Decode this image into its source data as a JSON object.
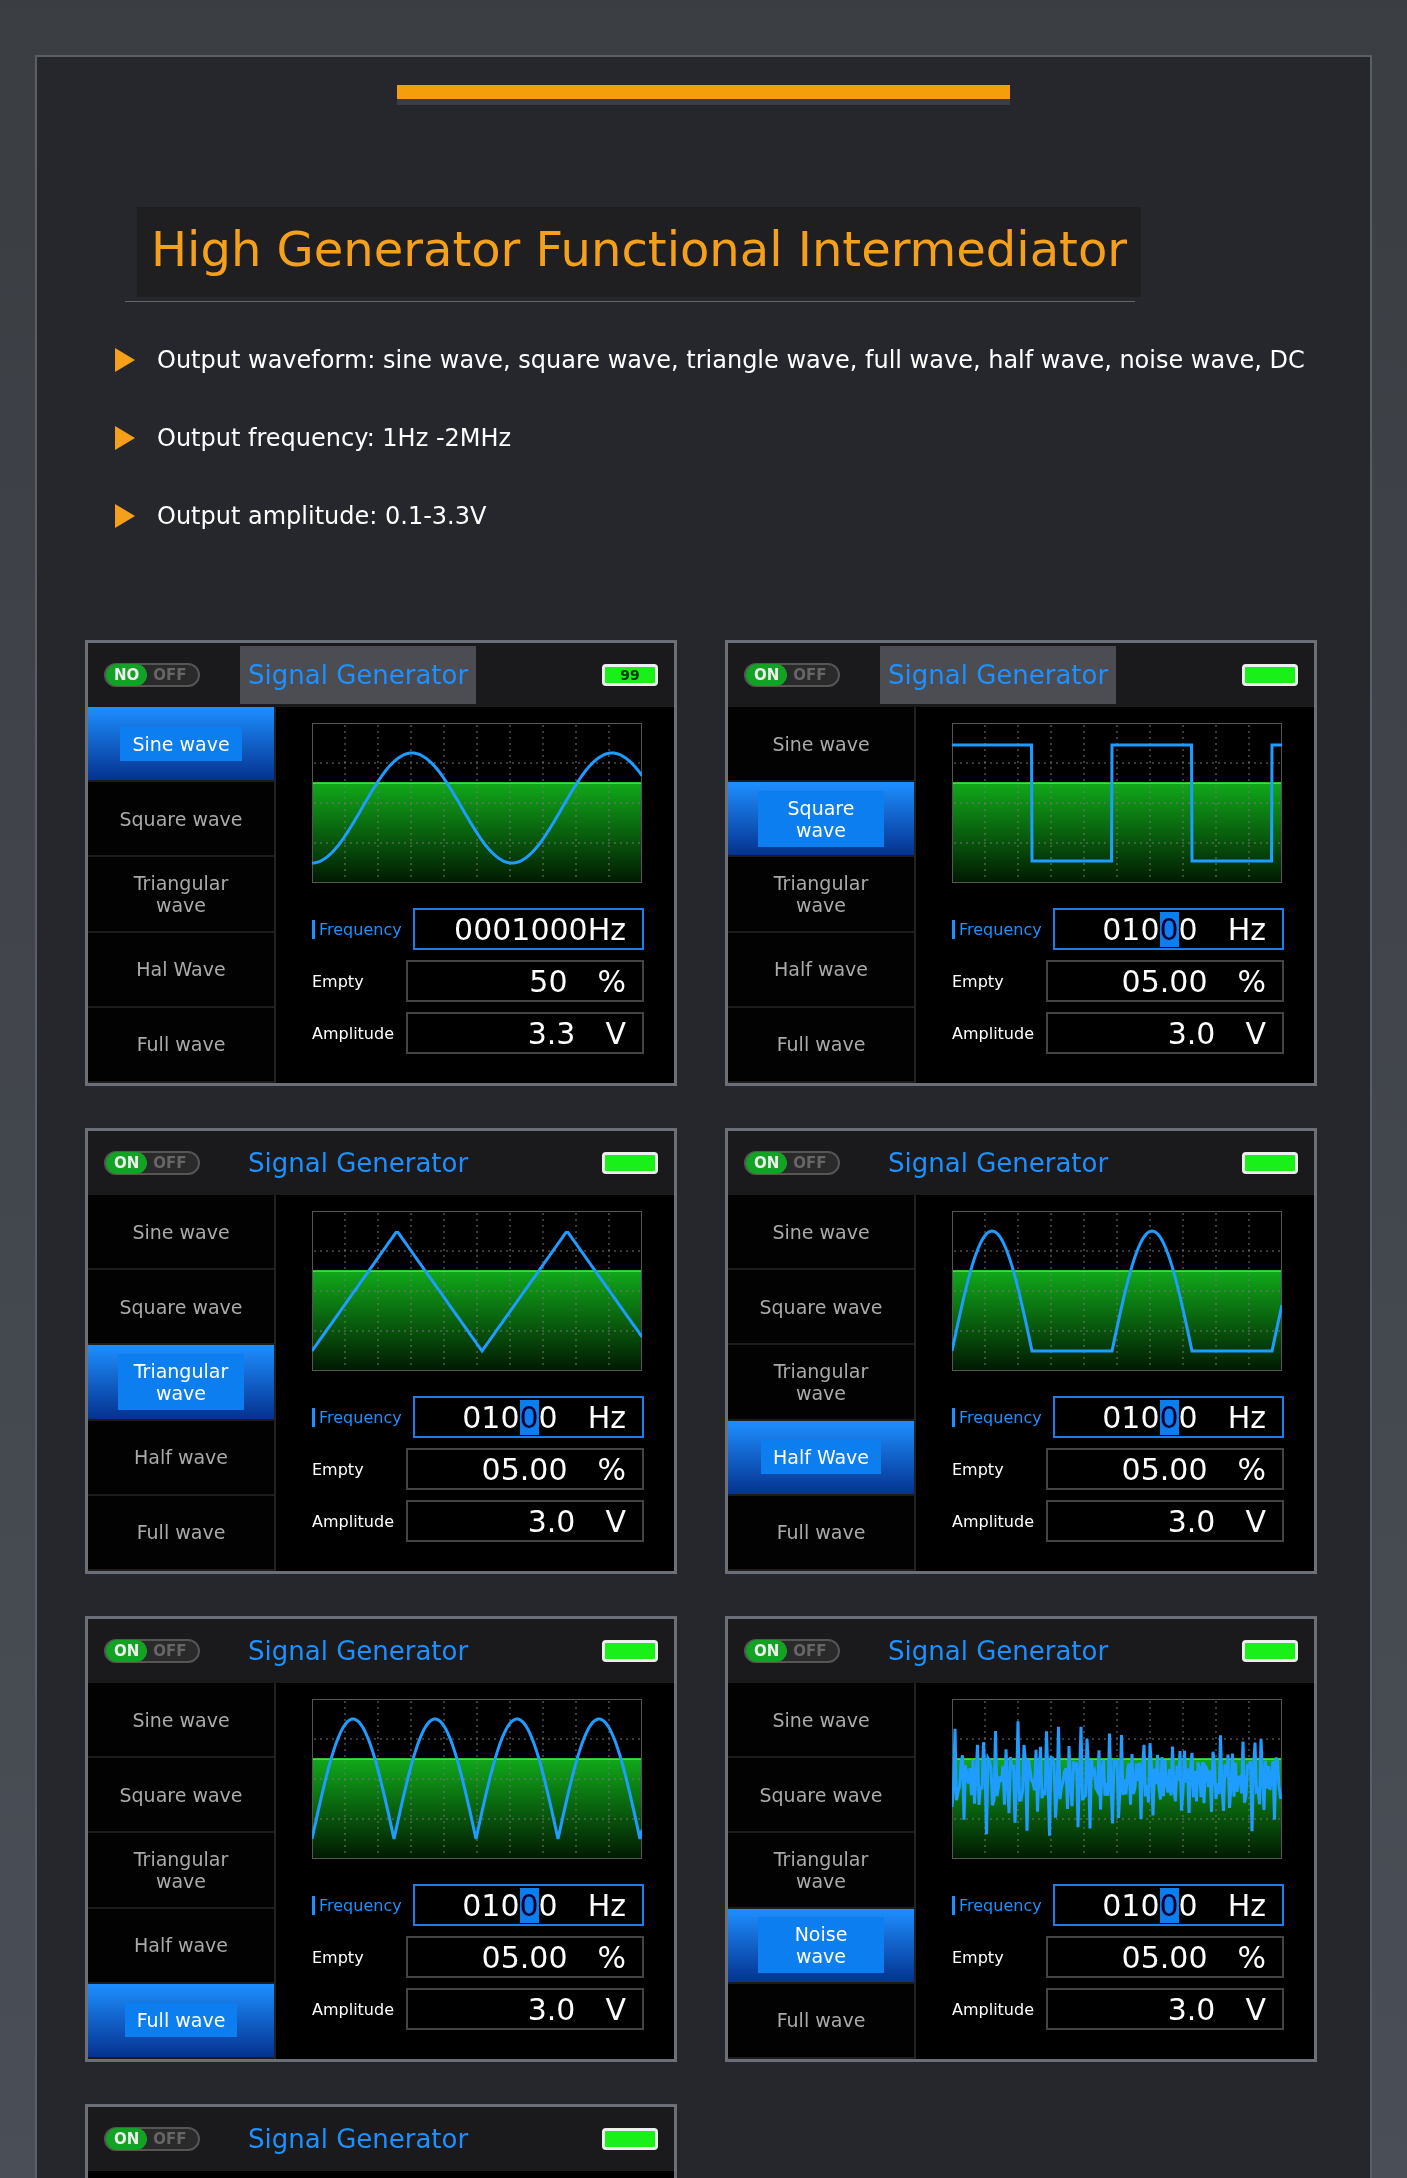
{
  "heading": "High Generator Functional Intermediator",
  "features": [
    "Output waveform: sine wave, square wave, triangle wave, full wave, half wave, noise wave, DC",
    "Output frequency: 1Hz -2MHz",
    "Output amplitude: 0.1-3.3V"
  ],
  "screens": [
    {
      "switch": {
        "on_label": "NO",
        "off_label": "OFF",
        "on": true
      },
      "title": "Signal Generator",
      "title_highlighted": true,
      "battery_text": "99",
      "kind": "sine",
      "menu": [
        {
          "label": "Sine wave",
          "selected": true
        },
        {
          "label": "Square wave",
          "selected": false
        },
        {
          "label": "Triangular wave",
          "selected": false
        },
        {
          "label": "Hal Wave",
          "selected": false
        },
        {
          "label": "Full wave",
          "selected": false
        }
      ],
      "fields": [
        {
          "kind": "frequency",
          "label": "Frequency",
          "value": [
            {
              "text": "0001000Hz",
              "selected": false
            }
          ]
        },
        {
          "kind": "duty",
          "label": "Empty",
          "value": [
            {
              "text": "50",
              "selected": false
            }
          ],
          "unit": "%"
        },
        {
          "kind": "amplitude",
          "label": "Amplitude",
          "value": [
            {
              "text": "3.3",
              "selected": false
            }
          ],
          "unit": "V"
        }
      ]
    },
    {
      "switch": {
        "on_label": "ON",
        "off_label": "OFF",
        "on": true
      },
      "title": "Signal Generator",
      "title_highlighted": true,
      "kind": "square",
      "menu": [
        {
          "label": "Sine wave",
          "selected": false
        },
        {
          "label": "Square wave",
          "selected": true
        },
        {
          "label": "Triangular wave",
          "selected": false
        },
        {
          "label": "Half wave",
          "selected": false
        },
        {
          "label": "Full wave",
          "selected": false
        }
      ],
      "fields": [
        {
          "kind": "frequency",
          "label": "Frequency",
          "value": [
            {
              "text": "010",
              "selected": false
            },
            {
              "text": "0",
              "selected": true
            },
            {
              "text": "0",
              "selected": false
            }
          ],
          "unit": "Hz"
        },
        {
          "kind": "duty",
          "label": "Empty",
          "value": [
            {
              "text": "05.00",
              "selected": false
            }
          ],
          "unit": "%"
        },
        {
          "kind": "amplitude",
          "label": "Amplitude",
          "value": [
            {
              "text": "3.0",
              "selected": false
            }
          ],
          "unit": "V"
        }
      ]
    },
    {
      "switch": {
        "on_label": "ON",
        "off_label": "OFF",
        "on": true
      },
      "title": "Signal Generator",
      "title_highlighted": false,
      "kind": "triangle",
      "menu": [
        {
          "label": "Sine wave",
          "selected": false
        },
        {
          "label": "Square wave",
          "selected": false
        },
        {
          "label": "Triangular wave",
          "selected": true
        },
        {
          "label": "Half wave",
          "selected": false
        },
        {
          "label": "Full wave",
          "selected": false
        }
      ],
      "fields": [
        {
          "kind": "frequency",
          "label": "Frequency",
          "value": [
            {
              "text": "010",
              "selected": false
            },
            {
              "text": "0",
              "selected": true
            },
            {
              "text": "0",
              "selected": false
            }
          ],
          "unit": "Hz"
        },
        {
          "kind": "duty",
          "label": "Empty",
          "value": [
            {
              "text": "05.00",
              "selected": false
            }
          ],
          "unit": "%"
        },
        {
          "kind": "amplitude",
          "label": "Amplitude",
          "value": [
            {
              "text": "3.0",
              "selected": false
            }
          ],
          "unit": "V"
        }
      ]
    },
    {
      "switch": {
        "on_label": "ON",
        "off_label": "OFF",
        "on": true
      },
      "title": "Signal Generator",
      "title_highlighted": false,
      "kind": "half",
      "menu": [
        {
          "label": "Sine wave",
          "selected": false
        },
        {
          "label": "Square wave",
          "selected": false
        },
        {
          "label": "Triangular wave",
          "selected": false
        },
        {
          "label": "Half Wave",
          "selected": true
        },
        {
          "label": "Full wave",
          "selected": false
        }
      ],
      "fields": [
        {
          "kind": "frequency",
          "label": "Frequency",
          "value": [
            {
              "text": "010",
              "selected": false
            },
            {
              "text": "0",
              "selected": true
            },
            {
              "text": "0",
              "selected": false
            }
          ],
          "unit": "Hz"
        },
        {
          "kind": "duty",
          "label": "Empty",
          "value": [
            {
              "text": "05.00",
              "selected": false
            }
          ],
          "unit": "%"
        },
        {
          "kind": "amplitude",
          "label": "Amplitude",
          "value": [
            {
              "text": "3.0",
              "selected": false
            }
          ],
          "unit": "V"
        }
      ]
    },
    {
      "switch": {
        "on_label": "ON",
        "off_label": "OFF",
        "on": true
      },
      "title": "Signal Generator",
      "title_highlighted": false,
      "kind": "full",
      "menu": [
        {
          "label": "Sine wave",
          "selected": false
        },
        {
          "label": "Square wave",
          "selected": false
        },
        {
          "label": "Triangular wave",
          "selected": false
        },
        {
          "label": "Half wave",
          "selected": false
        },
        {
          "label": "Full wave",
          "selected": true
        }
      ],
      "fields": [
        {
          "kind": "frequency",
          "label": "Frequency",
          "value": [
            {
              "text": "010",
              "selected": false
            },
            {
              "text": "0",
              "selected": true
            },
            {
              "text": "0",
              "selected": false
            }
          ],
          "unit": "Hz"
        },
        {
          "kind": "duty",
          "label": "Empty",
          "value": [
            {
              "text": "05.00",
              "selected": false
            }
          ],
          "unit": "%"
        },
        {
          "kind": "amplitude",
          "label": "Amplitude",
          "value": [
            {
              "text": "3.0",
              "selected": false
            }
          ],
          "unit": "V"
        }
      ]
    },
    {
      "switch": {
        "on_label": "ON",
        "off_label": "OFF",
        "on": true
      },
      "title": "Signal Generator",
      "title_highlighted": false,
      "kind": "noise",
      "menu": [
        {
          "label": "Sine wave",
          "selected": false
        },
        {
          "label": "Square wave",
          "selected": false
        },
        {
          "label": "Triangular wave",
          "selected": false
        },
        {
          "label": "Noise wave",
          "selected": true
        },
        {
          "label": "Full wave",
          "selected": false
        }
      ],
      "fields": [
        {
          "kind": "frequency",
          "label": "Frequency",
          "value": [
            {
              "text": "010",
              "selected": false
            },
            {
              "text": "0",
              "selected": true
            },
            {
              "text": "0",
              "selected": false
            }
          ],
          "unit": "Hz"
        },
        {
          "kind": "duty",
          "label": "Empty",
          "value": [
            {
              "text": "05.00",
              "selected": false
            }
          ],
          "unit": "%"
        },
        {
          "kind": "amplitude",
          "label": "Amplitude",
          "value": [
            {
              "text": "3.0",
              "selected": false
            }
          ],
          "unit": "V"
        }
      ]
    },
    {
      "switch": {
        "on_label": "ON",
        "off_label": "OFF",
        "on": true
      },
      "title": "Signal Generator",
      "title_highlighted": false
    }
  ]
}
